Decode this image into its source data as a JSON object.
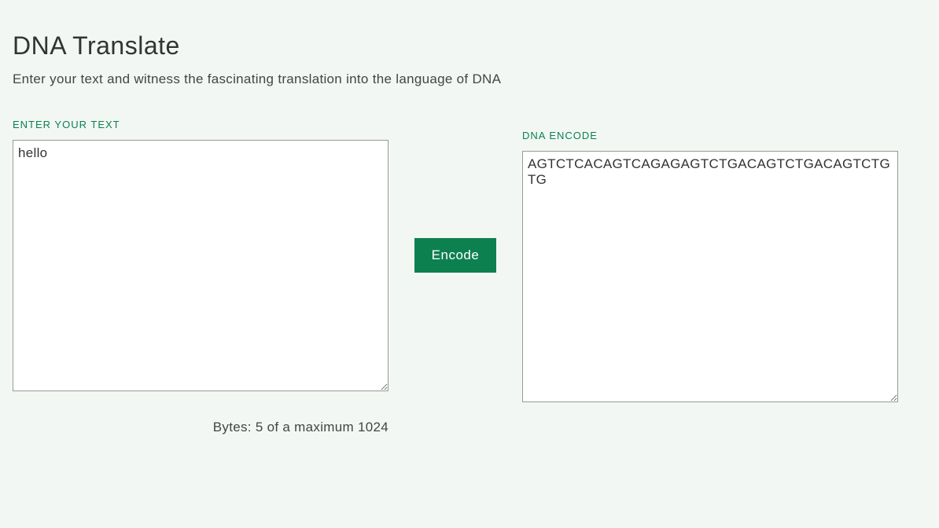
{
  "header": {
    "title": "DNA Translate",
    "subtitle": "Enter your text and witness the fascinating translation into the language of DNA"
  },
  "input": {
    "label": "ENTER YOUR TEXT",
    "value": "hello"
  },
  "output": {
    "label": "DNA ENCODE",
    "value": "AGTCTCACAGTCAGAGAGTCTGACAGTCTGACAGTCTGTG"
  },
  "action": {
    "encode_label": "Encode"
  },
  "status": {
    "bytes_text": "Bytes: 5 of a maximum 1024"
  }
}
